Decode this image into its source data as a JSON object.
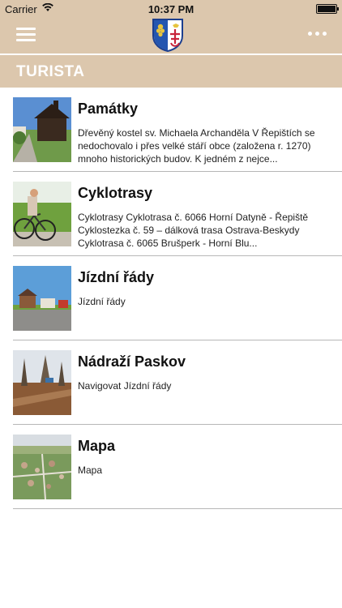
{
  "status_bar": {
    "carrier": "Carrier",
    "time": "10:37 PM"
  },
  "header": {
    "menu_icon": "hamburger-icon",
    "logo_icon": "coat-of-arms-icon",
    "more_icon": "more-dots-icon"
  },
  "section": {
    "title": "TURISTA"
  },
  "items": [
    {
      "title": "Památky",
      "description": "Dřevěný kostel sv. Michaela Archanděla  V Řepištích se nedochovalo i přes velké stáří obce (založena r. 1270) mnoho historických budov. K jedném z nejce..."
    },
    {
      "title": "Cyklotrasy",
      "description": "Cyklotrasy    Cyklotrasa č. 6066 Horní Datyně - Řepiště    Cyklostezka č. 59 – dálková trasa Ostrava-Beskydy    Cyklotrasa č. 6065 Brušperk - Horní Blu..."
    },
    {
      "title": "Jízdní řády",
      "description": "Jízdní řády"
    },
    {
      "title": "Nádraží Paskov",
      "description": "Navigovat    Jízdní řády"
    },
    {
      "title": "Mapa",
      "description": "Mapa"
    }
  ],
  "colors": {
    "accent": "#dcc7ad",
    "divider": "#b7b7b7"
  }
}
